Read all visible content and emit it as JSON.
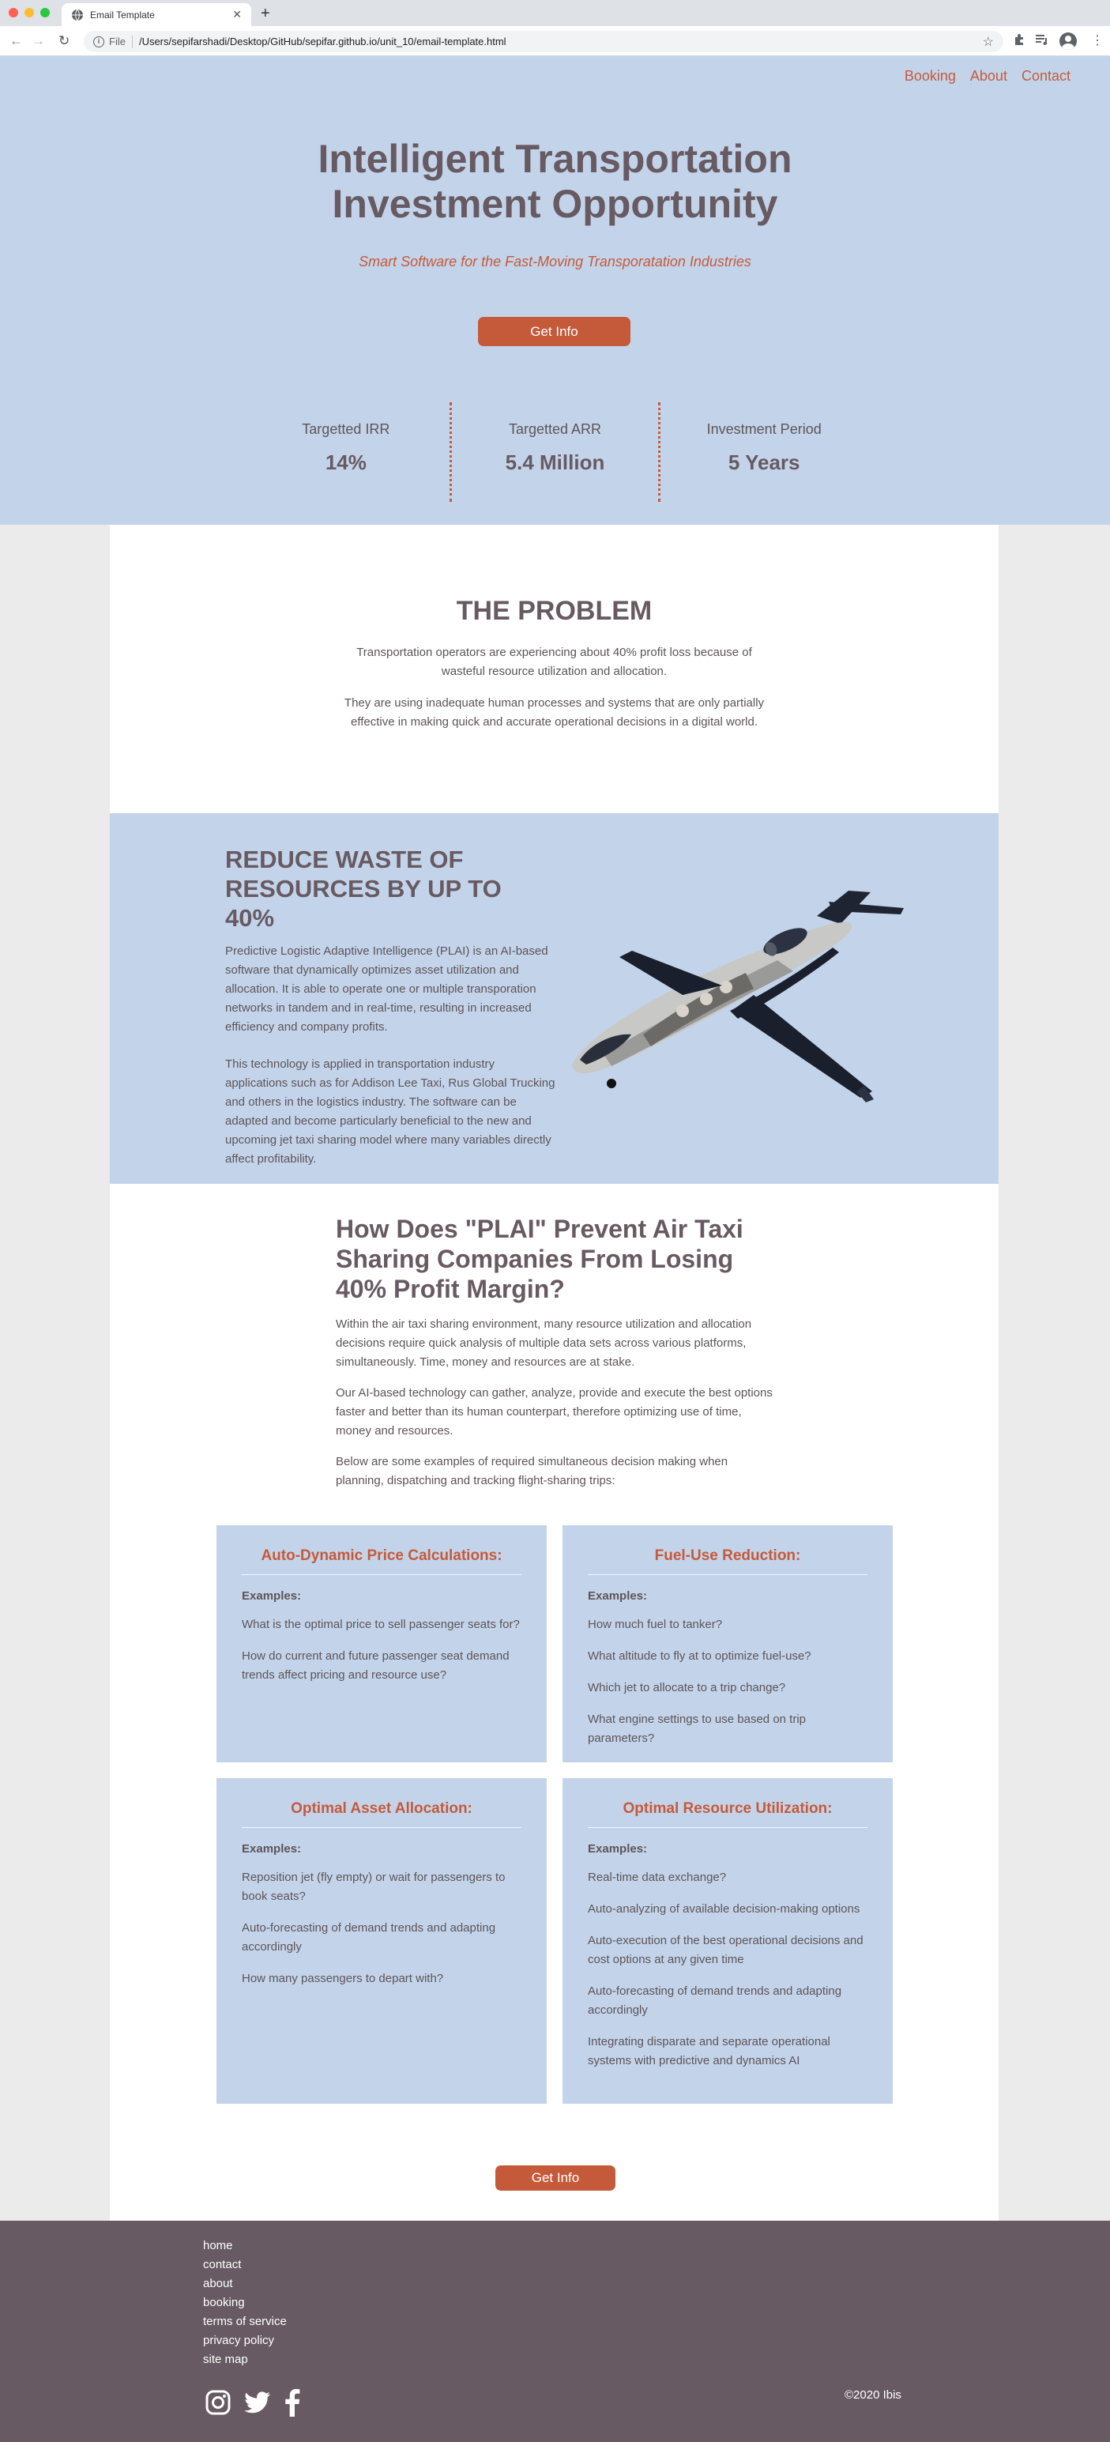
{
  "browser": {
    "tab_title": "Email Template",
    "new_tab": "+",
    "tab_close": "✕",
    "url_scheme": "File",
    "url": "/Users/sepifarshadi/Desktop/GitHub/sepifar.github.io/unit_10/email-template.html"
  },
  "nav": {
    "booking": "Booking",
    "about": "About",
    "contact": "Contact"
  },
  "hero": {
    "title_line1": "Intelligent Transportation",
    "title_line2": "Investment Opportunity",
    "subtitle": "Smart Software for the Fast-Moving Transporatation Industries",
    "button": "Get Info"
  },
  "stats": [
    {
      "label": "Targetted IRR",
      "value": "14%"
    },
    {
      "label": "Targetted ARR",
      "value": "5.4 Million"
    },
    {
      "label": "Investment Period",
      "value": "5 Years"
    }
  ],
  "problem": {
    "title": "THE PROBLEM",
    "p1": "Transportation operators are experiencing about 40% profit loss because of wasteful resource utilization and allocation.",
    "p2": "They are using inadequate human processes and systems that are only partially effective in making quick and accurate operational decisions in a digital world."
  },
  "reduce": {
    "title": "REDUCE WASTE OF RESOURCES BY UP TO 40%",
    "p1": "Predictive Logistic Adaptive Intelligence (PLAI) is an AI-based software that dynamically optimizes asset utilization and allocation. It is able to operate one or multiple transporation networks in tandem and in real-time, resulting in increased efficiency and company profits.",
    "p2": "This technology is applied in transportation industry applications such as for Addison Lee Taxi, Rus Global Trucking and others in the logistics industry. The software can be adapted and become particularly beneficial to the new and upcoming jet taxi sharing model where many variables directly affect profitability."
  },
  "how": {
    "title": "How Does \"PLAI\" Prevent Air Taxi Sharing Companies From Losing 40% Profit Margin?",
    "p1": "Within the air taxi sharing environment, many resource utilization and allocation decisions require quick analysis of multiple data sets across various platforms, simultaneously. Time, money and resources are at stake.",
    "p2": "Our AI-based technology can gather, analyze, provide and execute the best options faster and better than its human counterpart, therefore optimizing use of time, money and resources.",
    "p3": "Below are some examples of required simultaneous decision making when planning, dispatching and tracking flight-sharing trips:"
  },
  "cards": [
    {
      "title": "Auto-Dynamic Price Calculations:",
      "sub": "Examples:",
      "items": [
        "What is the optimal price to sell passenger seats for?",
        "How do current and future passenger seat demand trends affect pricing and resource use?"
      ]
    },
    {
      "title": "Fuel-Use Reduction:",
      "sub": "Examples:",
      "items": [
        "How much fuel to tanker?",
        "What altitude to fly at to optimize fuel-use?",
        "Which jet to allocate to a trip change?",
        "What engine settings to use based on trip parameters?"
      ]
    },
    {
      "title": "Optimal Asset Allocation:",
      "sub": "Examples:",
      "items": [
        "Reposition jet (fly empty) or wait for passengers to book seats?",
        "Auto-forecasting of demand trends and adapting accordingly",
        "How many passengers to depart with?"
      ]
    },
    {
      "title": "Optimal Resource Utilization:",
      "sub": "Examples:",
      "items": [
        "Real-time data exchange?",
        "Auto-analyzing of available decision-making options",
        "Auto-execution of the best operational decisions and cost options at any given time",
        "Auto-forecasting of demand trends and adapting accordingly",
        "Integrating disparate and separate operational systems with predictive and dynamics AI"
      ]
    }
  ],
  "footer_button": "Get Info",
  "footer": {
    "links": [
      "home",
      "contact",
      "about",
      "booking",
      "terms of service",
      "privacy policy",
      "site map"
    ],
    "copyright": "©2020 Ibis"
  },
  "icons": {
    "instagram": "instagram-icon",
    "twitter": "twitter-icon",
    "facebook": "facebook-icon"
  },
  "colors": {
    "accent": "#c55a3a",
    "hero_bg": "#c3d4ea",
    "heading": "#675a62",
    "footer_bg": "#675a62"
  }
}
